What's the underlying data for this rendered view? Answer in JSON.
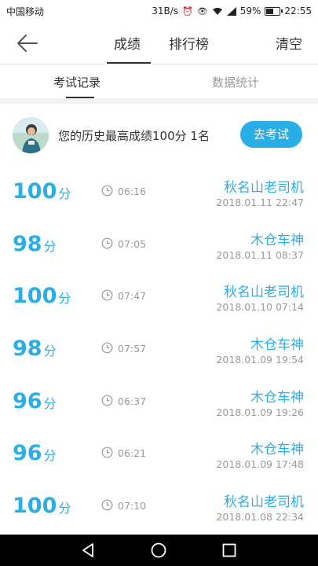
{
  "status_bar": {
    "carrier": "中国移动",
    "speed": "31B/s",
    "battery": "59%",
    "battery_level": 0.59,
    "time": "22:55"
  },
  "header": {
    "tabs": [
      {
        "label": "成绩"
      },
      {
        "label": "排行榜"
      }
    ],
    "clear_label": "清空"
  },
  "sub_tabs": [
    {
      "label": "考试记录"
    },
    {
      "label": "数据统计"
    }
  ],
  "summary": {
    "text": "您的历史最高成绩100分  1名",
    "button_label": "去考试"
  },
  "score_unit": "分",
  "records": [
    {
      "score": "100",
      "duration": "06:16",
      "driver": "秋名山老司机",
      "datetime": "2018.01.11  22:47"
    },
    {
      "score": "98",
      "duration": "07:05",
      "driver": "木仓车神",
      "datetime": "2018.01.11  08:37"
    },
    {
      "score": "100",
      "duration": "07:47",
      "driver": "秋名山老司机",
      "datetime": "2018.01.10  07:14"
    },
    {
      "score": "98",
      "duration": "07:57",
      "driver": "木仓车神",
      "datetime": "2018.01.09  19:54"
    },
    {
      "score": "96",
      "duration": "06:37",
      "driver": "木仓车神",
      "datetime": "2018.01.09  19:26"
    },
    {
      "score": "96",
      "duration": "06:21",
      "driver": "木仓车神",
      "datetime": "2018.01.09  17:48"
    },
    {
      "score": "100",
      "duration": "07:10",
      "driver": "秋名山老司机",
      "datetime": "2018.01.08  22:34"
    }
  ],
  "colors": {
    "accent": "#2aaee8",
    "secondary_text": "#999999",
    "primary_text": "#333333"
  },
  "icons": [
    "back-arrow-icon",
    "clock-icon",
    "eye-icon",
    "alarm-icon",
    "wifi-icon",
    "signal-icon",
    "battery-icon",
    "nav-back-icon",
    "nav-home-icon",
    "nav-recents-icon"
  ]
}
